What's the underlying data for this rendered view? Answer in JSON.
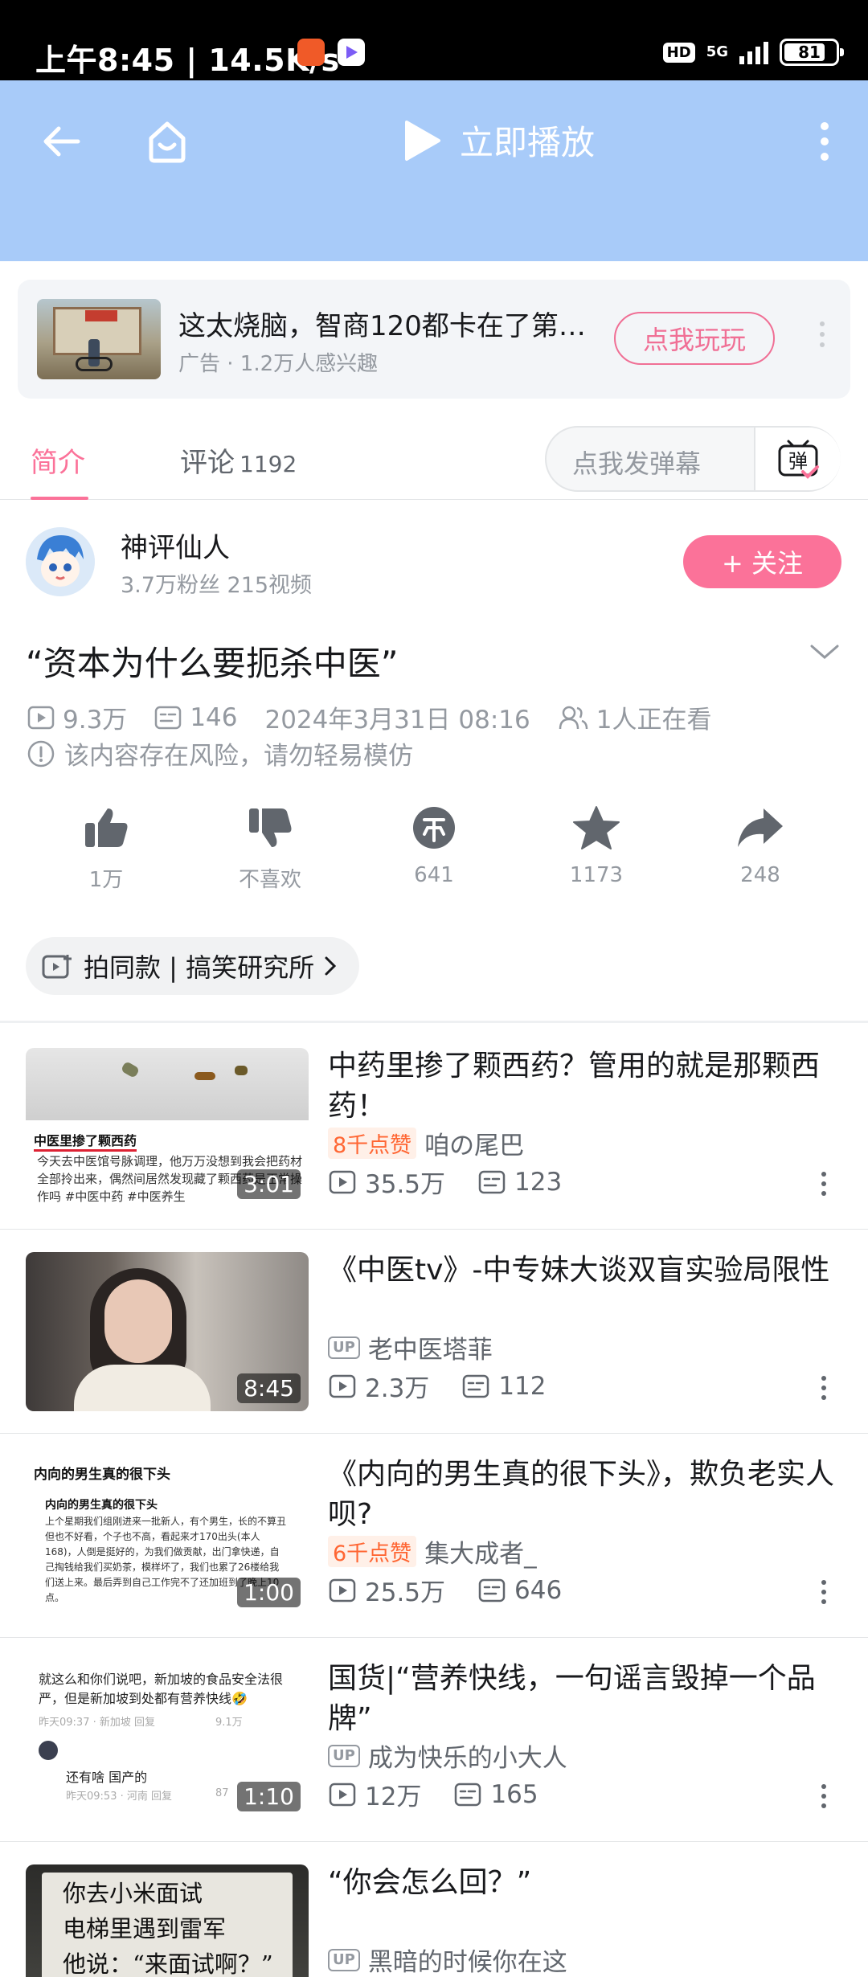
{
  "status_bar": {
    "time_speed": "上午8:45 | 14.5K/s",
    "hd": "HD",
    "network": "5G",
    "battery": "81"
  },
  "player": {
    "play_now_label": "立即播放"
  },
  "ad": {
    "title": "这太烧脑，智商120都卡在了第…",
    "meta": "广告 · 1.2万人感兴趣",
    "button": "点我玩玩"
  },
  "tabs": {
    "intro": "简介",
    "comments": "评论",
    "comment_count": "1192",
    "danmaku_placeholder": "点我发弹幕",
    "danmaku_icon_text": "弹"
  },
  "uploader": {
    "name": "神评仙人",
    "stats": "3.7万粉丝   215视频",
    "follow": "+ 关注"
  },
  "video": {
    "title": "“资本为什么要扼杀中医”",
    "views": "9.3万",
    "danmaku": "146",
    "date": "2024年3月31日 08:16",
    "watching": "1人正在看",
    "risk": "该内容存在风险，请勿轻易模仿"
  },
  "actions": [
    {
      "icon": "thumbs-up-icon",
      "label": "1万"
    },
    {
      "icon": "thumbs-down-icon",
      "label": "不喜欢"
    },
    {
      "icon": "coin-icon",
      "label": "641"
    },
    {
      "icon": "star-icon",
      "label": "1173"
    },
    {
      "icon": "share-icon",
      "label": "248"
    }
  ],
  "tag_pill": "拍同款 | 搞笑研究所",
  "recommendations": [
    {
      "title": "中药里掺了颗西药？管用的就是那颗西药！",
      "badge": "8千点赞",
      "up": "咱の尾巴",
      "views": "35.5万",
      "danmaku": "123",
      "duration": "3:01",
      "thumb_heading": "中医里掺了颗西药",
      "thumb_text": "今天去中医馆号脉调理，他万万没想到我会把药材全部拎出来，偶然间居然发现藏了颗西药是正常操作吗 #中医中药 #中医养生"
    },
    {
      "title": "《中医tv》-中专妹大谈双盲实验局限性",
      "badge": "",
      "up": "老中医塔菲",
      "views": "2.3万",
      "danmaku": "112",
      "duration": "8:45"
    },
    {
      "title": "《内向的男生真的很下头》，欺负老实人呗?",
      "badge": "6千点赞",
      "up": "集大成者_",
      "views": "25.5万",
      "danmaku": "646",
      "duration": "1:00",
      "thumb_heading": "内向的男生真的很下头",
      "thumb_sub": "内向的男生真的很下头",
      "thumb_text": "上个星期我们组刚进来一批新人，有个男生，长的不算丑但也不好看，个子也不高，看起来才170出头(本人168)，人倒是挺好的，为我们做贡献，出门拿快递，自己掏钱给我们买奶茶，模样坏了，我们也累了26楼给我们送上来。最后弄到自己工作完不了还加班到了晚上10点。"
    },
    {
      "title": "国货|“营养快线，一句谣言毁掉一个品牌”",
      "badge": "",
      "up": "成为快乐的小大人",
      "views": "12万",
      "danmaku": "165",
      "duration": "1:10",
      "thumb_text": "就这么和你们说吧，新加坡的食品安全法很严，但是新加坡到处都有营养快线🤣",
      "thumb_meta": "昨天09:37 · 新加坡   回复",
      "thumb_likes": "9.1万",
      "thumb_text2": "还有啥 国产的",
      "thumb_meta2": "昨天09:53 · 河南   回复",
      "thumb_likes2": "87"
    },
    {
      "title": "“你会怎么回？”",
      "badge": "",
      "up": "黑暗的时候你在这",
      "views": "",
      "danmaku": "",
      "duration": "",
      "thumb_text": "你去小米面试\n电梯里遇到雷军\n他说：“来面试啊？”"
    }
  ],
  "colors": {
    "accent": "#fb7299",
    "player_bg": "#a8cbf9",
    "badge_orange": "#ff6633"
  }
}
